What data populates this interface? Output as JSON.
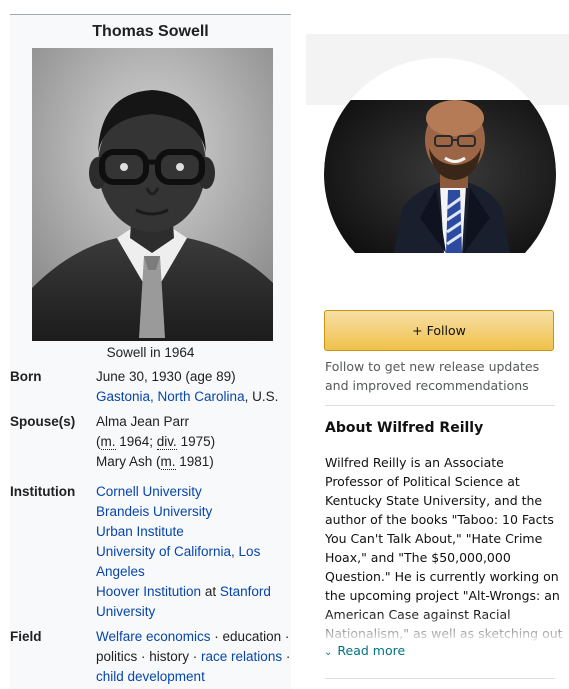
{
  "infobox": {
    "title": "Thomas Sowell",
    "caption": "Sowell in 1964",
    "born": {
      "label": "Born",
      "date": "June 30, 1930 (age 89)",
      "place_link": "Gastonia, North Carolina",
      "place_rest": ", U.S."
    },
    "spouse": {
      "label": "Spouse(s)",
      "name1": "Alma Jean Parr",
      "open_paren": "(",
      "m_abbr": "m.",
      "m_year": " 1964; ",
      "div_abbr": "div.",
      "div_year": " 1975)",
      "name2_prefix": "Mary Ash (",
      "m2_abbr": "m.",
      "m2_year": " 1981)"
    },
    "institution": {
      "label": "Institution",
      "items": [
        "Cornell University",
        "Brandeis University",
        "Urban Institute",
        "University of California, Los",
        "Angeles"
      ],
      "hoover_link": "Hoover Institution",
      "at_text": " at ",
      "stanford_link": "Stanford",
      "stanford_line2": "University"
    },
    "field": {
      "label": "Field",
      "welfare": "Welfare economics",
      "sep1": " · education ·",
      "politics": "politics · history · ",
      "race": "race relations",
      "sep2": " ·",
      "child": "child development"
    }
  },
  "author": {
    "follow_label": "+ Follow",
    "follow_help": "Follow to get new release updates and improved recommendations",
    "about_heading": "About Wilfred Reilly",
    "bio": "Wilfred Reilly is an Associate Professor of Political Science at Kentucky State University, and the author of the books \"Taboo: 10 Facts You Can't Talk About,\" \"Hate Crime Hoax,\" and \"The $50,000,000 Question.\" He is currently working on the upcoming project \"Alt-Wrongs: an American Case against Racial Nationalism,\" as well as sketching out a book looking at the",
    "read_more": "Read more",
    "colors": {
      "button": "#f0c14b",
      "link": "#007185",
      "wiki_link": "#0645ad"
    }
  }
}
